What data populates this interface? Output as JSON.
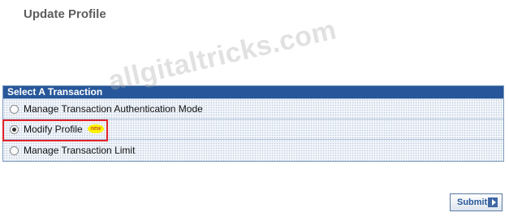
{
  "page": {
    "title": "Update Profile"
  },
  "transaction_panel": {
    "header": "Select A Transaction",
    "options": [
      {
        "label": "Manage Transaction Authentication Mode",
        "selected": false
      },
      {
        "label": "Modify Profile",
        "selected": true,
        "badge": "new"
      },
      {
        "label": "Manage Transaction Limit",
        "selected": false
      }
    ]
  },
  "watermark": "allgitaltricks.com",
  "actions": {
    "submit_label": "Submit"
  },
  "colors": {
    "header_bg": "#27579a",
    "highlight": "#e2232a",
    "badge_bg": "#fff200"
  }
}
